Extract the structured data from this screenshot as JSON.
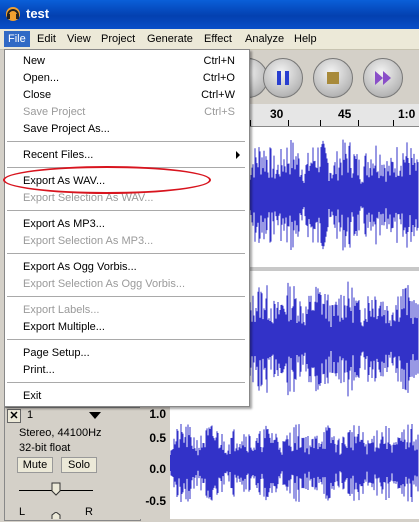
{
  "window": {
    "title": "test"
  },
  "menubar": [
    "File",
    "Edit",
    "View",
    "Project",
    "Generate",
    "Effect",
    "Analyze",
    "Help"
  ],
  "file_menu": {
    "items": [
      {
        "label": "New",
        "shortcut": "Ctrl+N"
      },
      {
        "label": "Open...",
        "shortcut": "Ctrl+O"
      },
      {
        "label": "Close",
        "shortcut": "Ctrl+W"
      },
      {
        "label": "Save Project",
        "shortcut": "Ctrl+S"
      },
      {
        "label": "Save Project As..."
      },
      {
        "label": "Recent Files..."
      },
      {
        "label": "Export As WAV..."
      },
      {
        "label": "Export Selection As WAV..."
      },
      {
        "label": "Export As MP3..."
      },
      {
        "label": "Export Selection As MP3..."
      },
      {
        "label": "Export As Ogg Vorbis..."
      },
      {
        "label": "Export Selection As Ogg Vorbis..."
      },
      {
        "label": "Export Labels..."
      },
      {
        "label": "Export Multiple..."
      },
      {
        "label": "Page Setup..."
      },
      {
        "label": "Print..."
      },
      {
        "label": "Exit"
      }
    ]
  },
  "ruler": {
    "ticks": [
      "30",
      "45",
      "1:0"
    ]
  },
  "track": {
    "name": "1",
    "info1": "Stereo, 44100Hz",
    "info2": "32-bit float",
    "mute": "Mute",
    "solo": "Solo",
    "pan_left": "L",
    "pan_right": "R",
    "scale": [
      "1.0",
      "0.5",
      "0.0",
      "-0.5"
    ]
  },
  "colors": {
    "waveform": "#3232c8",
    "highlight_oval": "#d8141e",
    "menu_active": "#316ac5"
  }
}
